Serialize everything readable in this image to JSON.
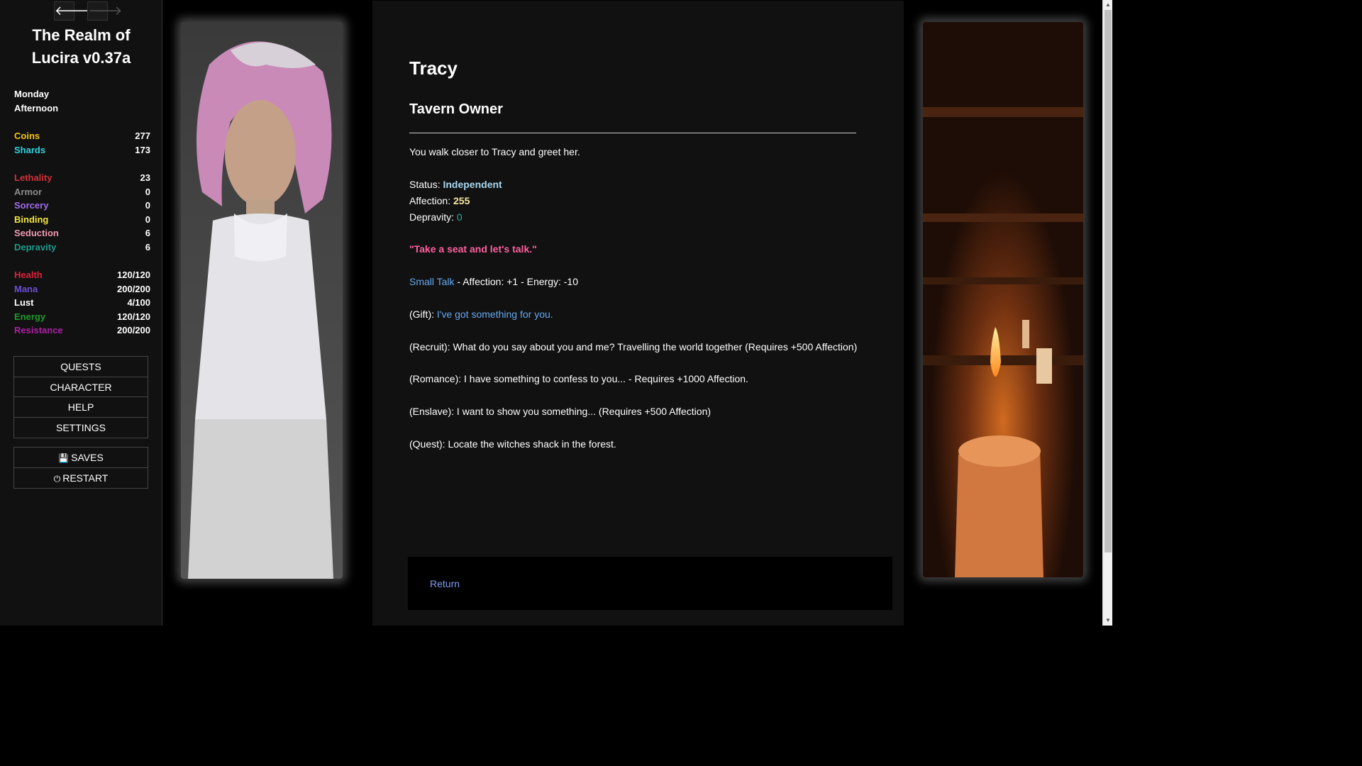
{
  "sidebar": {
    "back_icon": "arrow-left-icon",
    "forward_icon": "arrow-right-icon",
    "title": "The Realm of Lucira v0.37a",
    "day": "Monday",
    "time": "Afternoon",
    "currency": [
      {
        "label": "Coins",
        "value": "277",
        "color": "#f5c518"
      },
      {
        "label": "Shards",
        "value": "173",
        "color": "#2fd3e0"
      }
    ],
    "attributes": [
      {
        "label": "Lethality",
        "value": "23",
        "color": "#d0303a"
      },
      {
        "label": "Armor",
        "value": "0",
        "color": "#8c8c8c"
      },
      {
        "label": "Sorcery",
        "value": "0",
        "color": "#a46cf0"
      },
      {
        "label": "Binding",
        "value": "0",
        "color": "#f4e542"
      },
      {
        "label": "Seduction",
        "value": "6",
        "color": "#f09ab0"
      },
      {
        "label": "Depravity",
        "value": "6",
        "color": "#1c9a8c"
      }
    ],
    "vitals": [
      {
        "label": "Health",
        "value": "120/120",
        "color": "#e0213a"
      },
      {
        "label": "Mana",
        "value": "200/200",
        "color": "#6b4fd0"
      },
      {
        "label": "Lust",
        "value": "4/100",
        "color": "#ffffff"
      },
      {
        "label": "Energy",
        "value": "120/120",
        "color": "#1f9a2b"
      },
      {
        "label": "Resistance",
        "value": "200/200",
        "color": "#b01fa8"
      }
    ],
    "menu": [
      "QUESTS",
      "CHARACTER",
      "HELP",
      "SETTINGS"
    ],
    "saves_label": "SAVES",
    "restart_label": "RESTART"
  },
  "passage": {
    "name": "Tracy",
    "role": "Tavern Owner",
    "intro": "You walk closer to Tracy and greet her.",
    "status_label": "Status: ",
    "status_value": "Independent",
    "affection_label": "Affection: ",
    "affection_value": "255",
    "depravity_label": "Depravity: ",
    "depravity_value": "0",
    "quote": "\"Take a seat and let's talk.\"",
    "small_talk_link": "Small Talk",
    "small_talk_info": " - Affection: +1 - Energy: -10",
    "gift_prefix": "(Gift): ",
    "gift_link": "I've got something for you.",
    "recruit": "(Recruit): What do you say about you and me? Travelling the world together (Requires +500 Affection)",
    "romance": "(Romance): I have something to confess to you... - Requires +1000 Affection.",
    "enslave": "(Enslave): I want to show you something... (Requires +500 Affection)",
    "quest": "(Quest): Locate the witches shack in the forest.",
    "return_link": "Return"
  },
  "colors": {
    "status_value": "#a8d8f0",
    "affection_value": "#f5e6a0",
    "depravity_value": "#2ab0a0",
    "quote": "#ff5fa0",
    "link": "#68a9f0"
  }
}
